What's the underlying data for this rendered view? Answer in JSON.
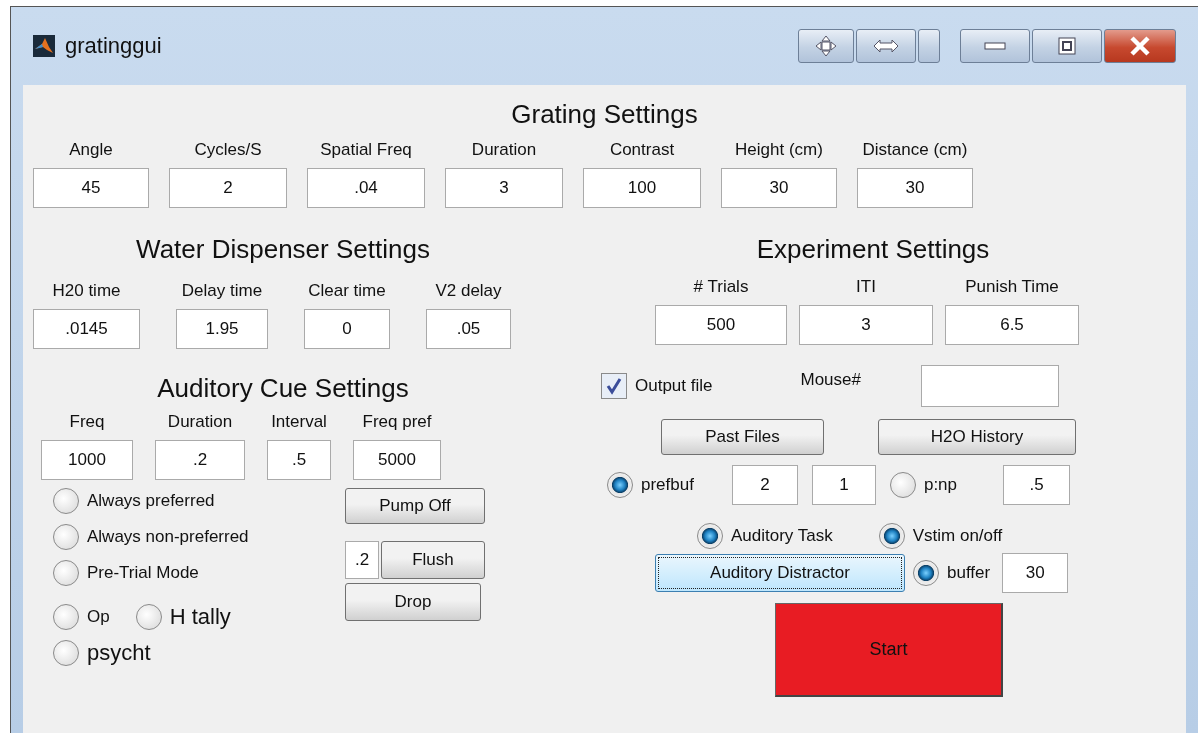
{
  "window": {
    "title": "gratinggui"
  },
  "grating_settings": {
    "title": "Grating Settings",
    "fields": [
      {
        "label": "Angle",
        "value": "45"
      },
      {
        "label": "Cycles/S",
        "value": "2"
      },
      {
        "label": "Spatial Freq",
        "value": ".04"
      },
      {
        "label": "Duration",
        "value": "3"
      },
      {
        "label": "Contrast",
        "value": "100"
      },
      {
        "label": "Height (cm)",
        "value": "30"
      },
      {
        "label": "Distance (cm)",
        "value": "30"
      }
    ]
  },
  "water_dispenser_settings": {
    "title": "Water Dispenser Settings",
    "fields": [
      {
        "label": "H20 time",
        "value": ".0145"
      },
      {
        "label": "Delay time",
        "value": "1.95"
      },
      {
        "label": "Clear time",
        "value": "0"
      },
      {
        "label": "V2 delay",
        "value": ".05"
      }
    ]
  },
  "auditory_cue_settings": {
    "title": "Auditory Cue Settings",
    "fields": [
      {
        "label": "Freq",
        "value": "1000"
      },
      {
        "label": "Duration",
        "value": ".2"
      },
      {
        "label": "Interval",
        "value": ".5"
      },
      {
        "label": "Freq pref",
        "value": "5000"
      }
    ],
    "mode_rows": [
      [
        {
          "label": "Always preferred",
          "selected": false
        }
      ],
      [
        {
          "label": "Always non-preferred",
          "selected": false
        }
      ],
      [
        {
          "label": "Pre-Trial Mode",
          "selected": false
        }
      ],
      [
        {
          "label": "Op",
          "selected": false
        },
        {
          "label": "H tally",
          "selected": false
        }
      ],
      [
        {
          "label": "psycht",
          "selected": false
        }
      ]
    ],
    "pump_button": "Pump Off",
    "flush_amount": ".2",
    "flush_button": "Flush",
    "drop_button": "Drop"
  },
  "experiment_settings": {
    "title": "Experiment Settings",
    "fields": [
      {
        "label": "# Trials",
        "value": "500"
      },
      {
        "label": "ITI",
        "value": "3"
      },
      {
        "label": "Punish Time",
        "value": "6.5"
      }
    ],
    "output_file": {
      "label": "Output file",
      "checked": true
    },
    "mouse_label": "Mouse#",
    "past_files_button": "Past Files",
    "h2o_history_button": "H2O History",
    "prefbuf": {
      "label": "prefbuf",
      "selected": true,
      "values": [
        "2",
        "1"
      ]
    },
    "pnp": {
      "label": "p:np",
      "selected": false,
      "value": ".5"
    },
    "auditory_task": {
      "label": "Auditory Task",
      "selected": true
    },
    "vstim": {
      "label": "Vstim on/off",
      "selected": true
    },
    "auditory_distractor": {
      "label": "Auditory Distractor",
      "focused": true
    },
    "buffer": {
      "label": "buffer",
      "selected": true,
      "value": "30"
    },
    "start_button": "Start"
  }
}
